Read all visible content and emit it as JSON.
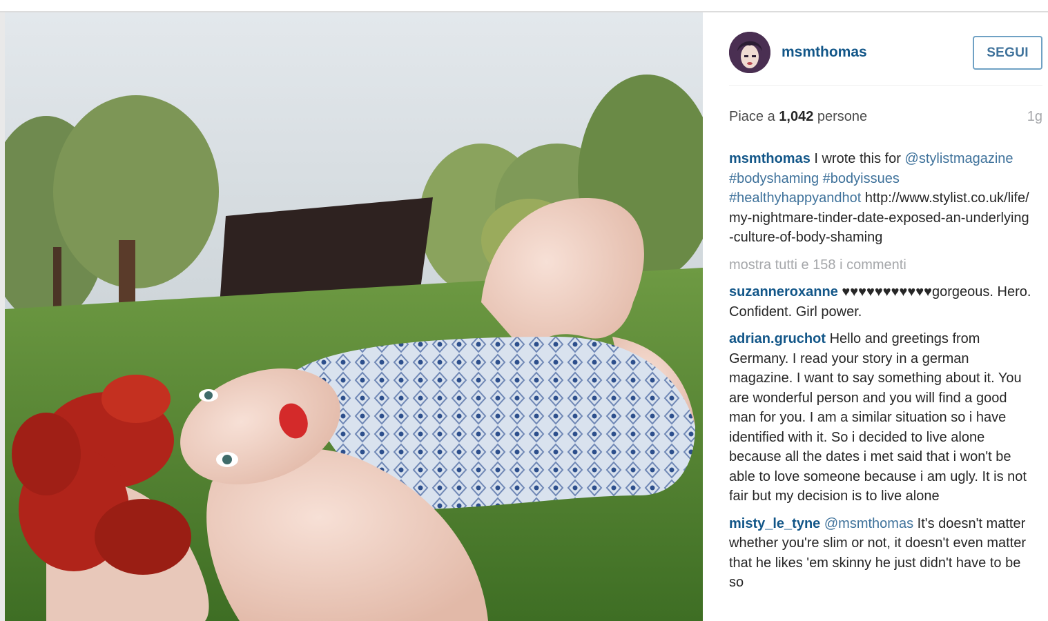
{
  "post": {
    "author": "msmthomas",
    "follow_label": "SEGUI",
    "likes_prefix": "Piace a ",
    "likes_count": "1,042",
    "likes_suffix": " persone",
    "time_ago": "1g",
    "caption": {
      "user": "msmthomas",
      "text": " I wrote this for ",
      "mention": "@stylistmagazine",
      "tags": "#bodyshaming #bodyissues #healthyhappyandhot",
      "url": "http://www.stylist.co.uk/life/my-nightmare-tinder-date-exposed-an-underlying-culture-of-body-shaming"
    },
    "show_all_comments": "mostra tutti e 158 i commenti",
    "comments": [
      {
        "user": "suzanneroxanne",
        "text": " ♥♥♥♥♥♥♥♥♥♥♥gorgeous. Hero. Confident. Girl power."
      },
      {
        "user": "adrian.gruchot",
        "text": " Hello and greetings from Germany. I read your story in a german magazine. I want to say something about it. You are wonderful person and you will find a good man for you. I am a similar situation so i have identified with it. So i decided to live alone because all the dates i met said that i won't be able to love someone because i am ugly. It is not fair but my decision is to live alone"
      },
      {
        "user": "misty_le_tyne",
        "mention": "@msmthomas",
        "text": " It's doesn't matter whether you're slim or not, it doesn't even matter that he likes 'em skinny he just didn't have to be so"
      }
    ]
  },
  "colors": {
    "username_blue": "#125688",
    "link_blue": "#3f729b",
    "muted_gray": "#a5a7aa"
  }
}
